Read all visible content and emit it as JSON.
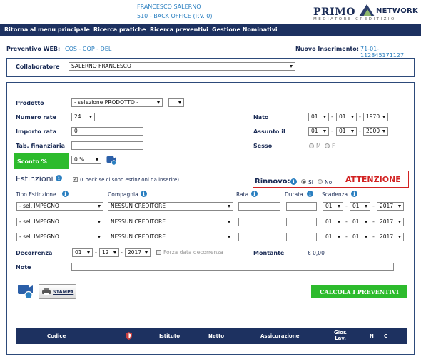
{
  "header": {
    "user_name": "FRANCESCO SALERNO",
    "user_office": "510 - BACK OFFICE (P.V. 0)",
    "logo": {
      "left": "PRIMO",
      "right": "NETWORK",
      "sub": "MEDIATORE CREDITIZIO"
    }
  },
  "nav": {
    "items": [
      "Ritorna al menu principale",
      "Ricerca pratiche",
      "Ricerca preventivi",
      "Gestione Nominativi"
    ]
  },
  "preventivo": {
    "label": "Preventivo WEB:",
    "types": "CQS - CQP - DEL",
    "new_label": "Nuovo Inserimento:",
    "new_code": "71-01-112845171127"
  },
  "collaboratore": {
    "label": "Collaboratore",
    "value": "SALERNO FRANCESCO"
  },
  "form": {
    "prodotto_label": "Prodotto",
    "prodotto_value": "- selezione PRODOTTO -",
    "prodotto_extra": "",
    "numero_rate_label": "Numero rate",
    "numero_rate_value": "24",
    "importo_rata_label": "Importo rata",
    "importo_rata_value": "0",
    "tab_finanziaria_label": "Tab. finanziaria",
    "tab_finanziaria_value": "",
    "sconto_label": "Sconto %",
    "sconto_value": "0 %",
    "nato_label": "Nato",
    "nato_day": "01",
    "nato_month": "01",
    "nato_year": "1970",
    "assunto_label": "Assunto il",
    "assunto_day": "01",
    "assunto_month": "01",
    "assunto_year": "2000",
    "sesso_label": "Sesso",
    "sesso_m": "M",
    "sesso_f": "F"
  },
  "estinzioni": {
    "title": "Estinzioni",
    "check_label": "(Check se ci sono estinzioni da inserire)",
    "rinnovo_label": "Rinnovo:",
    "rinnovo_si": "Si",
    "rinnovo_no": "No",
    "attenzione": "ATTENZIONE",
    "col_tipo": "Tipo Estinzione",
    "col_compagnia": "Compagnia",
    "col_rata": "Rata",
    "col_durata": "Durata",
    "col_scadenza": "Scadenza",
    "rows": [
      {
        "tipo": "- sel. IMPEGNO",
        "compagnia": "NESSUN CREDITORE",
        "rata": "",
        "durata": "",
        "day": "01",
        "month": "01",
        "year": "2017"
      },
      {
        "tipo": "- sel. IMPEGNO",
        "compagnia": "NESSUN CREDITORE",
        "rata": "",
        "durata": "",
        "day": "01",
        "month": "01",
        "year": "2017"
      },
      {
        "tipo": "- sel. IMPEGNO",
        "compagnia": "NESSUN CREDITORE",
        "rata": "",
        "durata": "",
        "day": "01",
        "month": "01",
        "year": "2017"
      }
    ]
  },
  "decorrenza": {
    "label": "Decorrenza",
    "day": "01",
    "month": "12",
    "year": "2017",
    "forza_label": "Forza data decorrenza",
    "montante_label": "Montante",
    "montante_value": "€ 0,00"
  },
  "note": {
    "label": "Note",
    "value": ""
  },
  "actions": {
    "stampa_label": "STAMPA",
    "calcola_label": "CALCOLA I PREVENTIVI"
  },
  "results_table": {
    "headers": [
      "Codice",
      "Istituto",
      "Netto",
      "Assicurazione",
      "Gior.\nLav.",
      "N",
      "C"
    ]
  },
  "colors": {
    "navy": "#1d3160",
    "blue": "#2a7fc0",
    "green": "#2dbb2d",
    "red": "#d22222"
  }
}
